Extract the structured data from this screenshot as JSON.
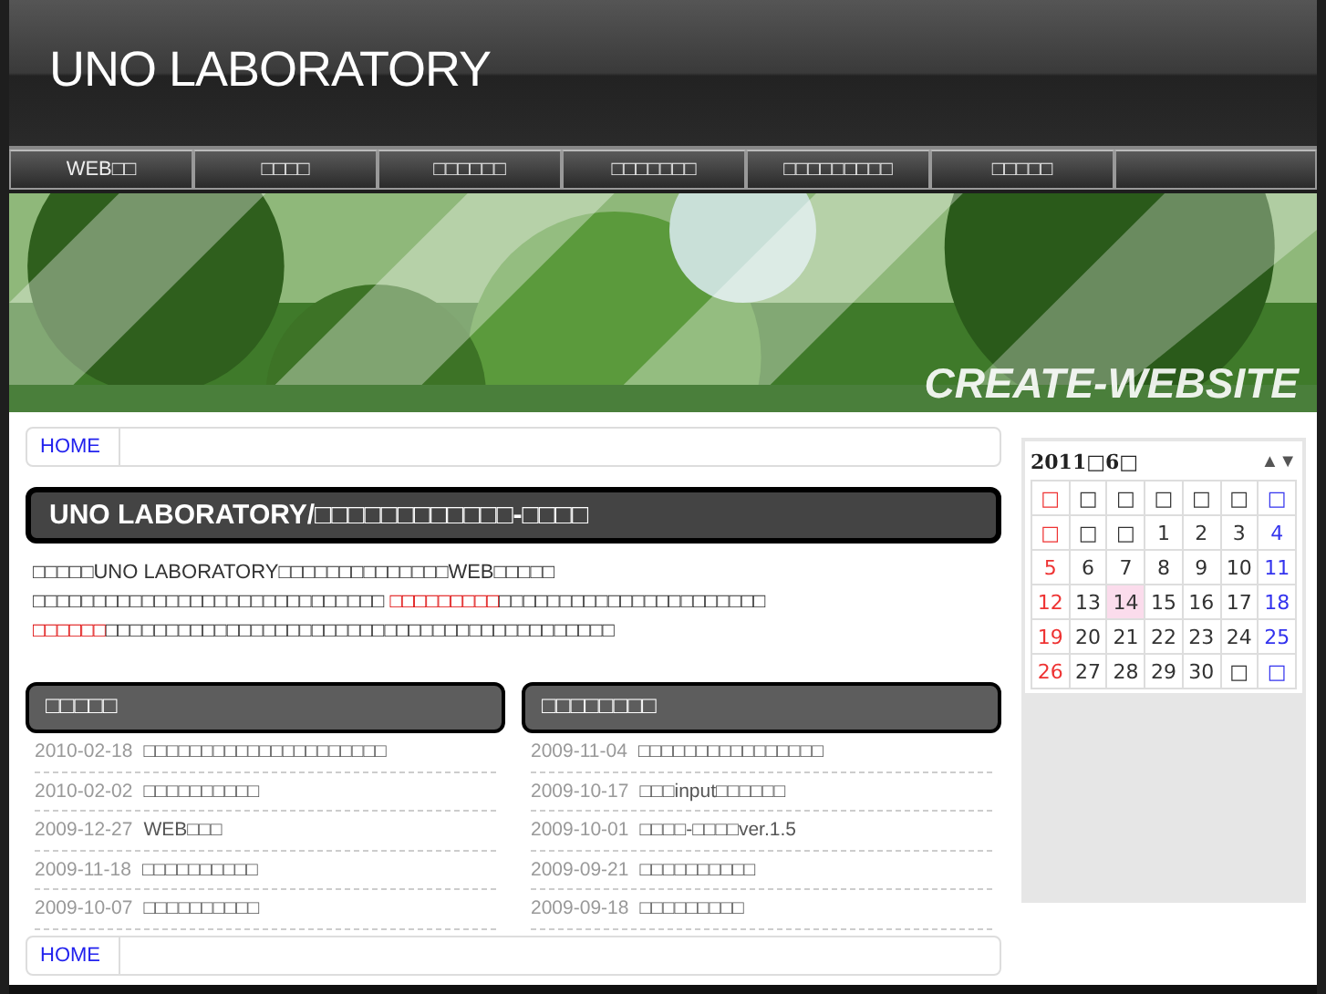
{
  "header": {
    "logo": "UNO LABORATORY"
  },
  "nav": [
    {
      "label": "WEB□□"
    },
    {
      "label": "□□□□"
    },
    {
      "label": "□□□□□□"
    },
    {
      "label": "□□□□□□□"
    },
    {
      "label": "□□□□□□□□□"
    },
    {
      "label": "□□□□□"
    }
  ],
  "banner": {
    "kind": "picture",
    "caption": "CREATE-WEBSITE"
  },
  "breadcrumb_top": [
    "HOME"
  ],
  "main_heading": "UNO LABORATORY/□□□□□□□□□□□□-□□□□",
  "intro": [
    [
      {
        "kind": "plain",
        "text": "□□□□□UNO LABORATORY□□□□□□□□□□□□□□WEB□□□□□"
      }
    ],
    [
      {
        "kind": "plain",
        "text": "□□□□□□□□□□□□□□□□□□□□□□□□□□□□□ "
      },
      {
        "kind": "highlight",
        "text": "□□□□□□□□□"
      },
      {
        "kind": "plain",
        "text": "□□□□□□□□□□□□□□□□□□□□□□ "
      },
      {
        "kind": "highlight",
        "text": "□□□□□□"
      },
      {
        "kind": "plain",
        "text": "□□□□□□□□□□□□□□□□□□□□□□□□□□□□□□□□□□□□□□□□□□"
      }
    ]
  ],
  "news": [
    {
      "title": "□□□□□",
      "items": [
        {
          "date": "2010-02-18",
          "title": "□□□□□□□□□□□□□□□□□□□□□"
        },
        {
          "date": "2010-02-02",
          "title": "□□□□□□□□□□"
        },
        {
          "date": "2009-12-27",
          "title": "WEB□□□"
        },
        {
          "date": "2009-11-18",
          "title": "□□□□□□□□□□"
        },
        {
          "date": "2009-10-07",
          "title": "□□□□□□□□□□"
        }
      ]
    },
    {
      "title": "□□□□□□□□",
      "items": [
        {
          "date": "2009-11-04",
          "title": "□□□□□□□□□□□□□□□□"
        },
        {
          "date": "2009-10-17",
          "title": "□□□input□□□□□□"
        },
        {
          "date": "2009-10-01",
          "title": "□□□□-□□□□ver.1.5"
        },
        {
          "date": "2009-09-21",
          "title": "□□□□□□□□□□"
        },
        {
          "date": "2009-09-18",
          "title": "□□□□□□□□□"
        }
      ]
    }
  ],
  "breadcrumb_bottom": [
    "HOME"
  ],
  "calendar": {
    "title": "2011□6□",
    "nav": "▲▼",
    "weekdays": [
      {
        "text": "□",
        "kind": "sun"
      },
      {
        "text": "□",
        "kind": "day"
      },
      {
        "text": "□",
        "kind": "day"
      },
      {
        "text": "□",
        "kind": "day"
      },
      {
        "text": "□",
        "kind": "day"
      },
      {
        "text": "□",
        "kind": "day"
      },
      {
        "text": "□",
        "kind": "sat"
      }
    ],
    "weeks": [
      [
        {
          "text": "□",
          "kind": "sun",
          "selected": false
        },
        {
          "text": "□",
          "kind": "day",
          "selected": false
        },
        {
          "text": "□",
          "kind": "day",
          "selected": false
        },
        {
          "text": "1",
          "kind": "day",
          "selected": false
        },
        {
          "text": "2",
          "kind": "day",
          "selected": false
        },
        {
          "text": "3",
          "kind": "day",
          "selected": false
        },
        {
          "text": "4",
          "kind": "sat",
          "selected": false
        }
      ],
      [
        {
          "text": "5",
          "kind": "sun",
          "selected": false
        },
        {
          "text": "6",
          "kind": "day",
          "selected": false
        },
        {
          "text": "7",
          "kind": "day",
          "selected": false
        },
        {
          "text": "8",
          "kind": "day",
          "selected": false
        },
        {
          "text": "9",
          "kind": "day",
          "selected": false
        },
        {
          "text": "10",
          "kind": "day",
          "selected": false
        },
        {
          "text": "11",
          "kind": "sat",
          "selected": false
        }
      ],
      [
        {
          "text": "12",
          "kind": "sun",
          "selected": false
        },
        {
          "text": "13",
          "kind": "day",
          "selected": false
        },
        {
          "text": "14",
          "kind": "day",
          "selected": true
        },
        {
          "text": "15",
          "kind": "day",
          "selected": false
        },
        {
          "text": "16",
          "kind": "day",
          "selected": false
        },
        {
          "text": "17",
          "kind": "day",
          "selected": false
        },
        {
          "text": "18",
          "kind": "sat",
          "selected": false
        }
      ],
      [
        {
          "text": "19",
          "kind": "sun",
          "selected": false
        },
        {
          "text": "20",
          "kind": "day",
          "selected": false
        },
        {
          "text": "21",
          "kind": "day",
          "selected": false
        },
        {
          "text": "22",
          "kind": "day",
          "selected": false
        },
        {
          "text": "23",
          "kind": "day",
          "selected": false
        },
        {
          "text": "24",
          "kind": "day",
          "selected": false
        },
        {
          "text": "25",
          "kind": "sat",
          "selected": false
        }
      ],
      [
        {
          "text": "26",
          "kind": "sun",
          "selected": false
        },
        {
          "text": "27",
          "kind": "day",
          "selected": false
        },
        {
          "text": "28",
          "kind": "day",
          "selected": false
        },
        {
          "text": "29",
          "kind": "day",
          "selected": false
        },
        {
          "text": "30",
          "kind": "day",
          "selected": false
        },
        {
          "text": "□",
          "kind": "day",
          "selected": false
        },
        {
          "text": "□",
          "kind": "sat",
          "selected": false
        }
      ]
    ]
  }
}
